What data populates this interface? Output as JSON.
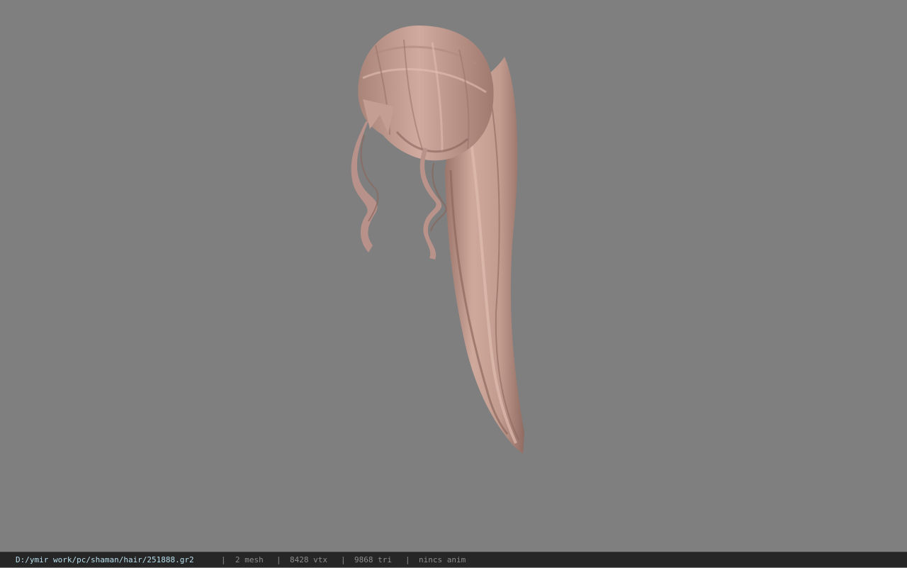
{
  "viewport": {
    "background_color": "#7f7f7f",
    "model_subject": "hair-mesh",
    "hair_color": "#c9a398"
  },
  "statusbar": {
    "file_path": "D:/ymir work/pc/shaman/hair/251888.gr2",
    "separator": "|",
    "mesh_count": "2 mesh",
    "vertex_count": "8428 vtx",
    "triangle_count": "9868 tri",
    "anim_status": "nincs anim"
  }
}
